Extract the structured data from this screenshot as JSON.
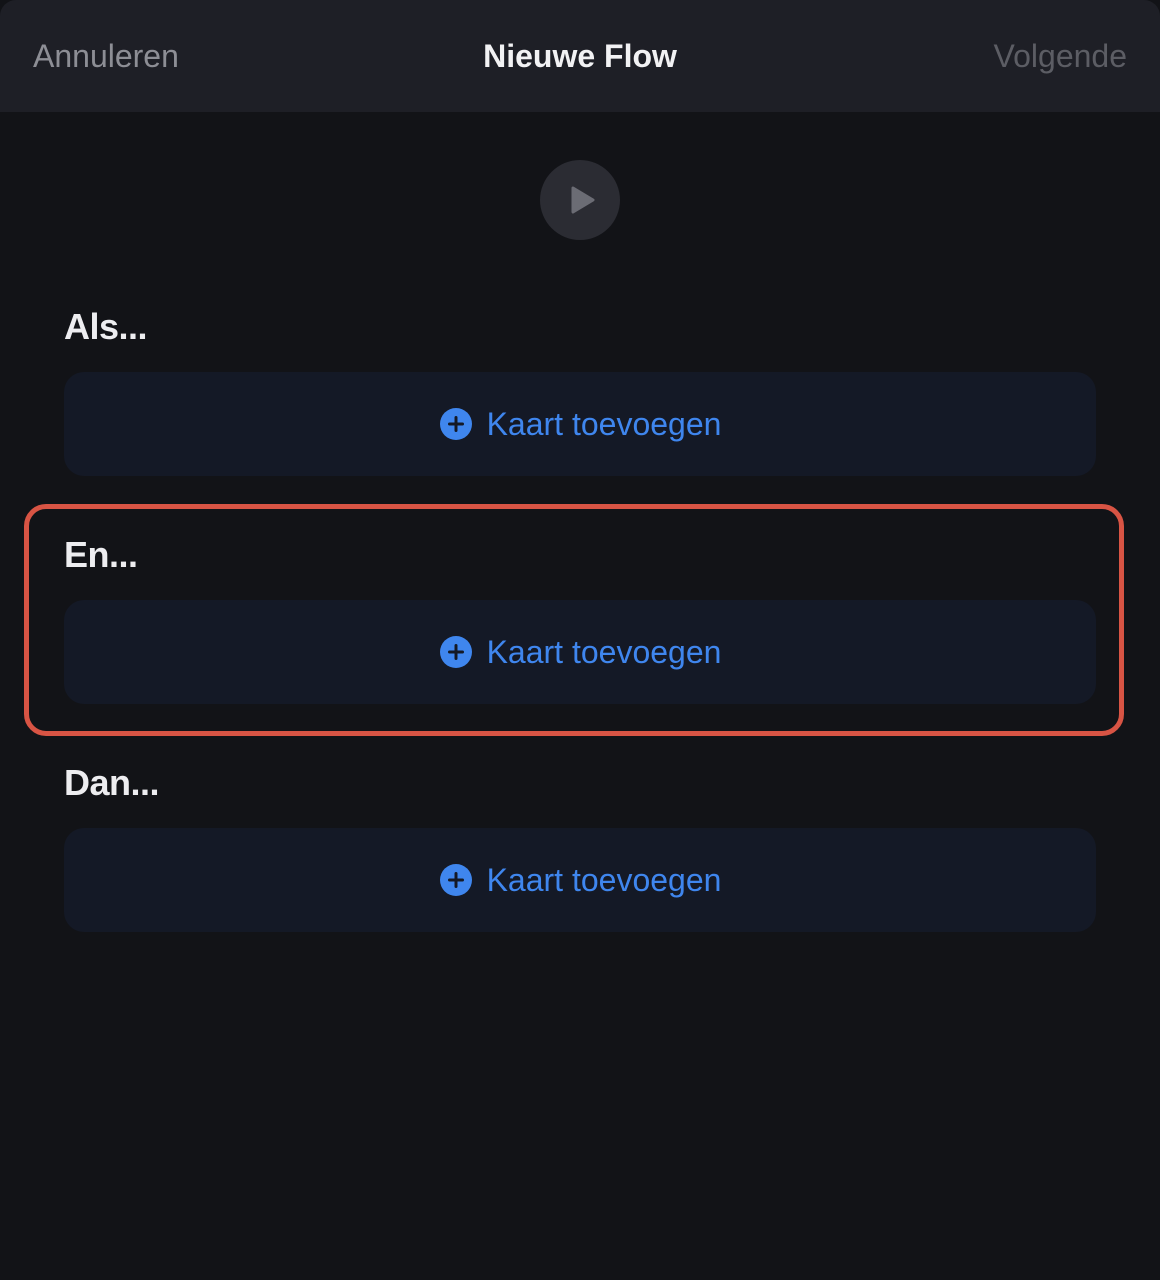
{
  "header": {
    "cancel_label": "Annuleren",
    "title": "Nieuwe Flow",
    "next_label": "Volgende"
  },
  "sections": [
    {
      "label": "Als...",
      "add_label": "Kaart toevoegen"
    },
    {
      "label": "En...",
      "add_label": "Kaart toevoegen"
    },
    {
      "label": "Dan...",
      "add_label": "Kaart toevoegen"
    }
  ],
  "icons": {
    "play": "play-icon",
    "add": "plus-circle-icon"
  },
  "colors": {
    "accent": "#3f86ee",
    "highlight": "#d85444",
    "background": "#121317",
    "header": "#1e1f26",
    "card": "#141926"
  }
}
